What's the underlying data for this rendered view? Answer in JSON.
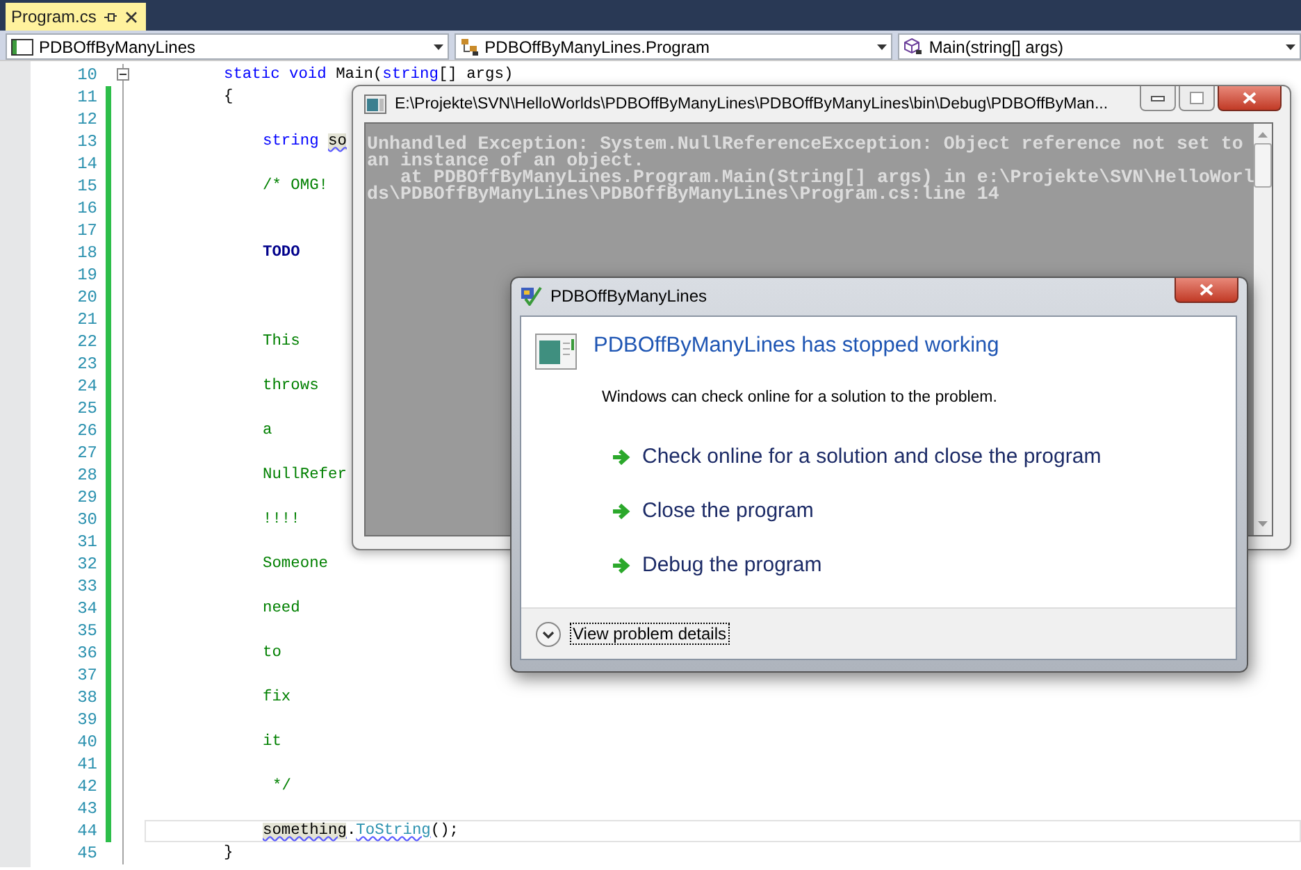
{
  "tabs": [
    {
      "label": "Program.cs",
      "selected": true
    }
  ],
  "navigation": [
    {
      "kind": "project",
      "label": "PDBOffByManyLines"
    },
    {
      "kind": "class",
      "label": "PDBOffByManyLines.Program"
    },
    {
      "kind": "method",
      "label": "Main(string[] args)"
    }
  ],
  "code_lines": [
    {
      "number": "10",
      "kind": "member",
      "changed": false,
      "foldable": true,
      "current": false,
      "segments": [
        {
          "kind": "keyword",
          "text": "static void"
        },
        {
          "kind": "plain",
          "text": " Main("
        },
        {
          "kind": "keyword",
          "text": "string"
        },
        {
          "kind": "plain",
          "text": "[] args)"
        }
      ]
    },
    {
      "number": "11",
      "kind": "member",
      "changed": true,
      "foldable": false,
      "current": false,
      "segments": [
        {
          "kind": "plain",
          "text": "{"
        }
      ]
    },
    {
      "number": "12",
      "kind": "body",
      "changed": true,
      "foldable": false,
      "current": false
    },
    {
      "number": "13",
      "kind": "body",
      "changed": true,
      "foldable": false,
      "current": false,
      "segments": [
        {
          "kind": "keyword",
          "text": "string"
        },
        {
          "kind": "ref",
          "text": "so"
        }
      ]
    },
    {
      "number": "14",
      "kind": "body",
      "changed": true,
      "foldable": false,
      "current": false
    },
    {
      "number": "15",
      "kind": "body",
      "changed": true,
      "foldable": false,
      "current": false,
      "segments": [
        {
          "kind": "comment",
          "text": "/* OMG!"
        }
      ]
    },
    {
      "number": "16",
      "kind": "body",
      "changed": true,
      "foldable": false,
      "current": false
    },
    {
      "number": "17",
      "kind": "body",
      "changed": true,
      "foldable": false,
      "current": false
    },
    {
      "number": "18",
      "kind": "body",
      "changed": true,
      "foldable": false,
      "current": false,
      "segments": [
        {
          "kind": "task",
          "text": "TODO"
        }
      ]
    },
    {
      "number": "19",
      "kind": "body",
      "changed": true,
      "foldable": false,
      "current": false
    },
    {
      "number": "20",
      "kind": "body",
      "changed": true,
      "foldable": false,
      "current": false
    },
    {
      "number": "21",
      "kind": "body",
      "changed": true,
      "foldable": false,
      "current": false
    },
    {
      "number": "22",
      "kind": "body",
      "changed": true,
      "foldable": false,
      "current": false,
      "segments": [
        {
          "kind": "comment",
          "text": "This"
        }
      ]
    },
    {
      "number": "23",
      "kind": "body",
      "changed": true,
      "foldable": false,
      "current": false
    },
    {
      "number": "24",
      "kind": "body",
      "changed": true,
      "foldable": false,
      "current": false,
      "segments": [
        {
          "kind": "comment",
          "text": "throws"
        }
      ]
    },
    {
      "number": "25",
      "kind": "body",
      "changed": true,
      "foldable": false,
      "current": false
    },
    {
      "number": "26",
      "kind": "body",
      "changed": true,
      "foldable": false,
      "current": false,
      "segments": [
        {
          "kind": "comment",
          "text": "a"
        }
      ]
    },
    {
      "number": "27",
      "kind": "body",
      "changed": true,
      "foldable": false,
      "current": false
    },
    {
      "number": "28",
      "kind": "body",
      "changed": true,
      "foldable": false,
      "current": false,
      "segments": [
        {
          "kind": "comment",
          "text": "NullRefer"
        }
      ]
    },
    {
      "number": "29",
      "kind": "body",
      "changed": true,
      "foldable": false,
      "current": false
    },
    {
      "number": "30",
      "kind": "body",
      "changed": true,
      "foldable": false,
      "current": false,
      "segments": [
        {
          "kind": "comment",
          "text": "!!!!"
        }
      ]
    },
    {
      "number": "31",
      "kind": "body",
      "changed": true,
      "foldable": false,
      "current": false
    },
    {
      "number": "32",
      "kind": "body",
      "changed": true,
      "foldable": false,
      "current": false,
      "segments": [
        {
          "kind": "comment",
          "text": "Someone"
        }
      ]
    },
    {
      "number": "33",
      "kind": "body",
      "changed": true,
      "foldable": false,
      "current": false
    },
    {
      "number": "34",
      "kind": "body",
      "changed": true,
      "foldable": false,
      "current": false,
      "segments": [
        {
          "kind": "comment",
          "text": "need"
        }
      ]
    },
    {
      "number": "35",
      "kind": "body",
      "changed": true,
      "foldable": false,
      "current": false
    },
    {
      "number": "36",
      "kind": "body",
      "changed": true,
      "foldable": false,
      "current": false,
      "segments": [
        {
          "kind": "comment",
          "text": "to"
        }
      ]
    },
    {
      "number": "37",
      "kind": "body",
      "changed": true,
      "foldable": false,
      "current": false
    },
    {
      "number": "38",
      "kind": "body",
      "changed": true,
      "foldable": false,
      "current": false,
      "segments": [
        {
          "kind": "comment",
          "text": "fix"
        }
      ]
    },
    {
      "number": "39",
      "kind": "body",
      "changed": true,
      "foldable": false,
      "current": false
    },
    {
      "number": "40",
      "kind": "body",
      "changed": true,
      "foldable": false,
      "current": false,
      "segments": [
        {
          "kind": "comment",
          "text": "it"
        }
      ]
    },
    {
      "number": "41",
      "kind": "body",
      "changed": true,
      "foldable": false,
      "current": false
    },
    {
      "number": "42",
      "kind": "comment-end",
      "changed": true,
      "foldable": false,
      "current": false,
      "segments": [
        {
          "kind": "comment",
          "text": "*/"
        }
      ]
    },
    {
      "number": "43",
      "kind": "body",
      "changed": true,
      "foldable": false,
      "current": false
    },
    {
      "number": "44",
      "kind": "body",
      "changed": true,
      "foldable": false,
      "current": true,
      "segments": [
        {
          "kind": "ref",
          "text": "something"
        },
        {
          "kind": "plain",
          "text": "."
        },
        {
          "kind": "call",
          "text": "ToString"
        },
        {
          "kind": "plain",
          "text": "();"
        }
      ]
    },
    {
      "number": "45",
      "kind": "member",
      "changed": false,
      "foldable": false,
      "current": false,
      "segments": [
        {
          "kind": "plain",
          "text": "}"
        }
      ]
    }
  ],
  "console_window": {
    "title": "E:\\Projekte\\SVN\\HelloWorlds\\PDBOffByManyLines\\PDBOffByManyLines\\bin\\Debug\\PDBOffByMan...",
    "lines": [
      "Unhandled Exception: System.NullReferenceException: Object reference not set to",
      "an instance of an object.",
      "   at PDBOffByManyLines.Program.Main(String[] args) in e:\\Projekte\\SVN\\HelloWorl",
      "ds\\PDBOffByManyLines\\PDBOffByManyLines\\Program.cs:line 14"
    ]
  },
  "error_dialog": {
    "title": "PDBOffByManyLines",
    "heading": "PDBOffByManyLines has stopped working",
    "message": "Windows can check online for a solution to the problem.",
    "options": [
      "Check online for a solution and close the program",
      "Close the program",
      "Debug the program"
    ],
    "details_link": {
      "label": "View problem details",
      "focused": true
    }
  }
}
